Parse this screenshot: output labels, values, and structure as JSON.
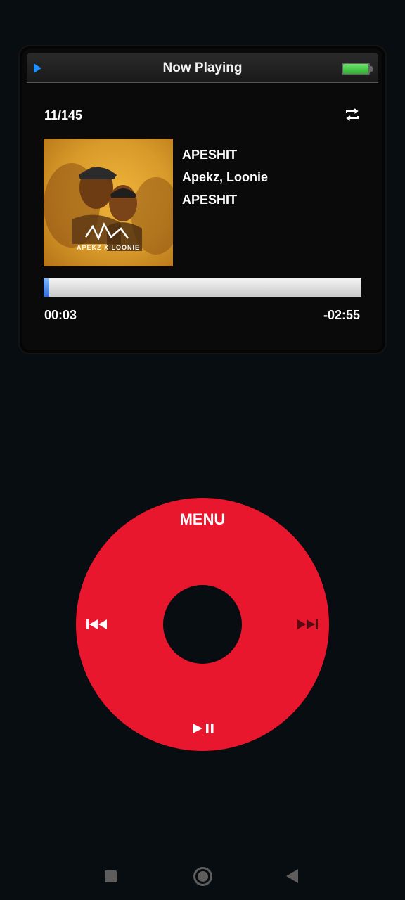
{
  "header": {
    "title": "Now Playing",
    "play_indicator_icon": "play-icon",
    "battery_icon": "battery-icon",
    "battery_level": 1.0,
    "battery_color": "#3fc63f"
  },
  "track": {
    "position": "11/145",
    "repeat_icon": "repeat-icon",
    "title": "APESHIT",
    "artist": "Apekz, Loonie",
    "album": "APESHIT",
    "artwork_caption": "APEKZ X LOONIE"
  },
  "playback": {
    "elapsed": "00:03",
    "remaining": "-02:55",
    "progress_fraction": 0.017,
    "progress_color": "#2d6fd8"
  },
  "click_wheel": {
    "menu_label": "MENU",
    "prev_icon": "previous-track-icon",
    "next_icon": "next-track-icon",
    "play_pause_icon": "play-pause-icon",
    "wheel_color": "#e8172d"
  },
  "system_nav": {
    "recents_icon": "recents-square-icon",
    "home_icon": "home-circle-icon",
    "back_icon": "back-triangle-icon"
  }
}
